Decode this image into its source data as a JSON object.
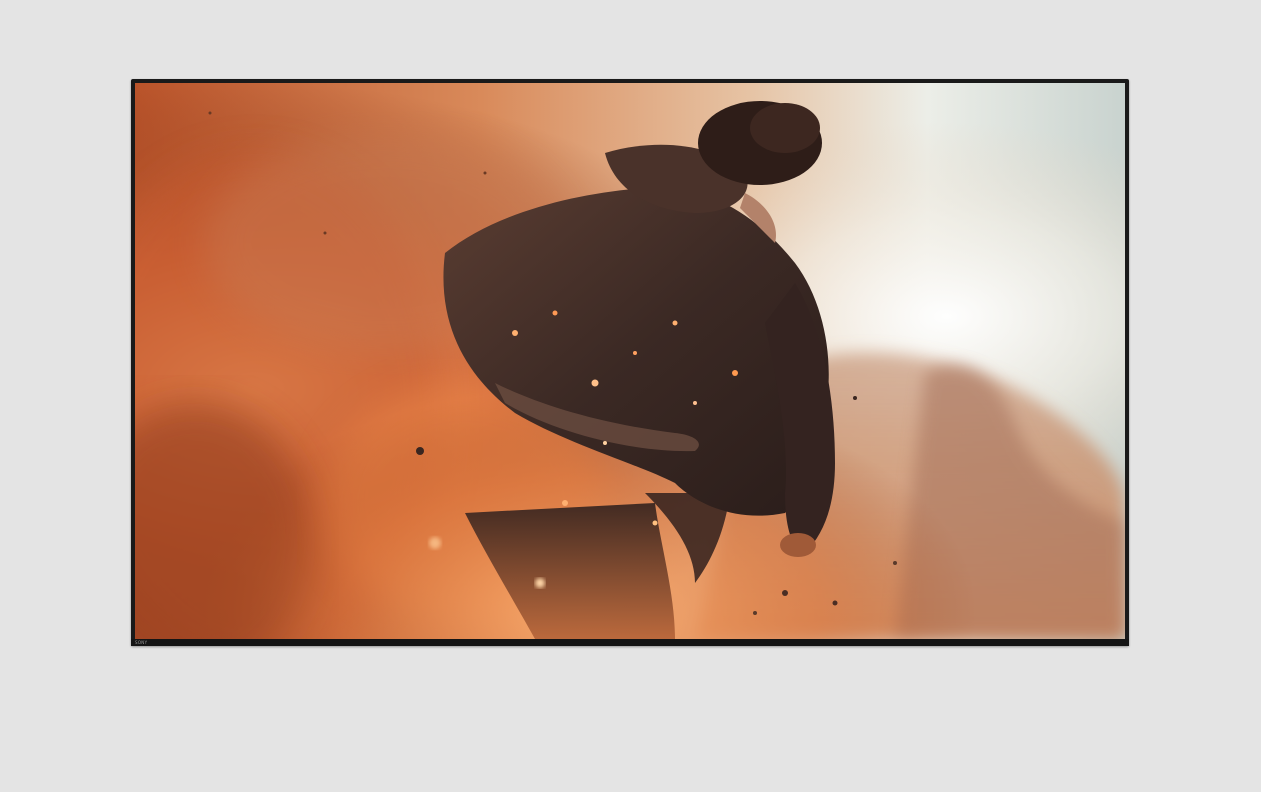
{
  "product": {
    "brand_logo_text": "SONY"
  },
  "colors": {
    "page_background": "#e4e4e4",
    "bezel": "#1a1a1a",
    "screen_fire": "#d9733a",
    "screen_sky": "#e9ece6",
    "figure_jacket": "#3a2a24"
  },
  "screen_image": {
    "subject": "person-in-jacket-walking-through-fiery-dust"
  }
}
